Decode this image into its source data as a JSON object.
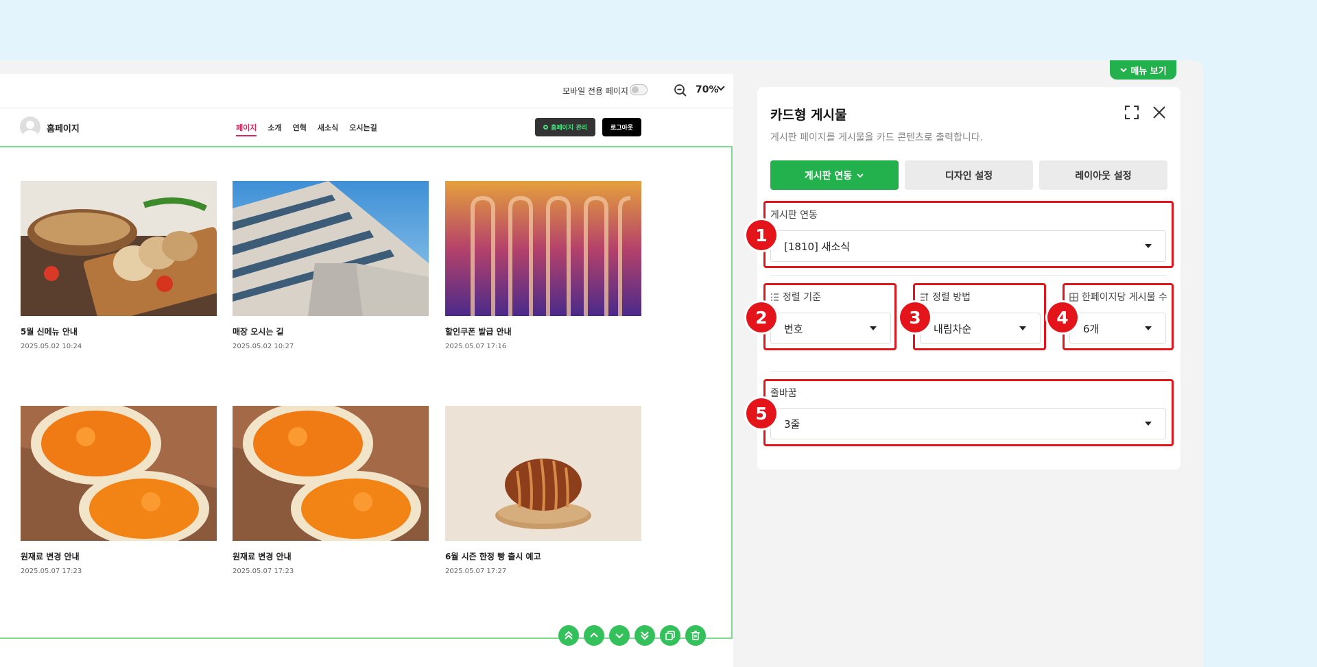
{
  "topbar": {
    "mobile_label": "모바일 전용 페이지",
    "zoom": "70%"
  },
  "site": {
    "title": "홈페이지",
    "nav": [
      "페이지",
      "소개",
      "연혁",
      "새소식",
      "오시는길"
    ],
    "manage_label": "홈페이지 관리",
    "logout_label": "로그아웃"
  },
  "cards": [
    {
      "title": "5월 신메뉴 안내",
      "date": "2025.05.02 10:24"
    },
    {
      "title": "매장 오시는 길",
      "date": "2025.05.02 10:27"
    },
    {
      "title": "할인쿠폰 발급 안내",
      "date": "2025.05.07 17:16"
    },
    {
      "title": "원재료 변경 안내",
      "date": "2025.05.07 17:23"
    },
    {
      "title": "원재료 변경 안내",
      "date": "2025.05.07 17:23"
    },
    {
      "title": "6월 시즌 한정 빵 출시 예고",
      "date": "2025.05.07 17:27"
    }
  ],
  "menu_tab_label": "메뉴 보기",
  "panel": {
    "title": "카드형 게시물",
    "desc": "게시판 페이지를 게시물을 카드 콘텐츠로 출력합니다.",
    "tabs": [
      "게시판 연동",
      "디자인 설정",
      "레이아웃 설정"
    ],
    "board_link": {
      "label": "게시판 연동",
      "value": "[1810] 새소식"
    },
    "sort_by": {
      "label": "정렬 기준",
      "value": "번호"
    },
    "sort_order": {
      "label": "정렬 방법",
      "value": "내림차순"
    },
    "per_page": {
      "label": "한페이지당 게시물 수",
      "value": "6개"
    },
    "row_wrap": {
      "label": "줄바꿈",
      "value": "3줄"
    }
  },
  "badges": [
    "1",
    "2",
    "3",
    "4",
    "5"
  ],
  "colors": {
    "accent": "#23b14d",
    "highlight": "#e4141b",
    "nav_active": "#e0245e"
  }
}
